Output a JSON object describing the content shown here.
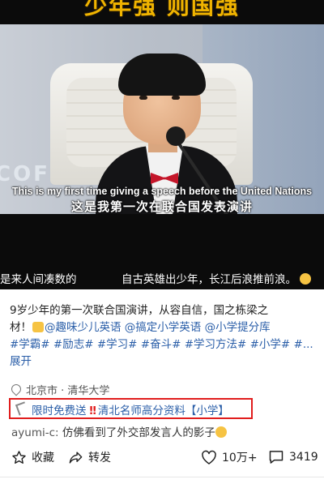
{
  "video": {
    "title_text": "少年强 则国强",
    "subtitle_en": "This is my first time giving a speech before the United Nations",
    "subtitle_cn": "这是我第一次在联合国发表演讲",
    "scroll_left": "是来人间凑数的",
    "scroll_right": "自古英雄出少年，长江后浪推前浪。",
    "background_text": "COF"
  },
  "post": {
    "line1": "9岁少年的第一次联合国演讲，从容自信，国之栋梁之",
    "line2_prefix": "材！",
    "tags_line2": [
      "@趣味少儿英语",
      "@搞定小学英语",
      "@小学提分库"
    ],
    "tags_line3": [
      "#学霸#",
      "#励志#",
      "#学习#",
      "#奋斗#",
      "#学习方法#",
      "#小学#",
      "#..."
    ],
    "expand": "展开",
    "location": "北京市 · 清华大学"
  },
  "promo": {
    "left_text": "限时免费送",
    "right_text": "清北名师高分资料【小学】"
  },
  "comment": {
    "user": "ayumi-c:",
    "text": "仿佛看到了外交部发言人的影子"
  },
  "actions": {
    "favorite": "收藏",
    "share": "转发",
    "likes": "10万+",
    "comments": "3419"
  },
  "colors": {
    "link_blue": "#2a5ea8",
    "promo_red": "#e11d1d",
    "title_gold": "#f0b400"
  }
}
